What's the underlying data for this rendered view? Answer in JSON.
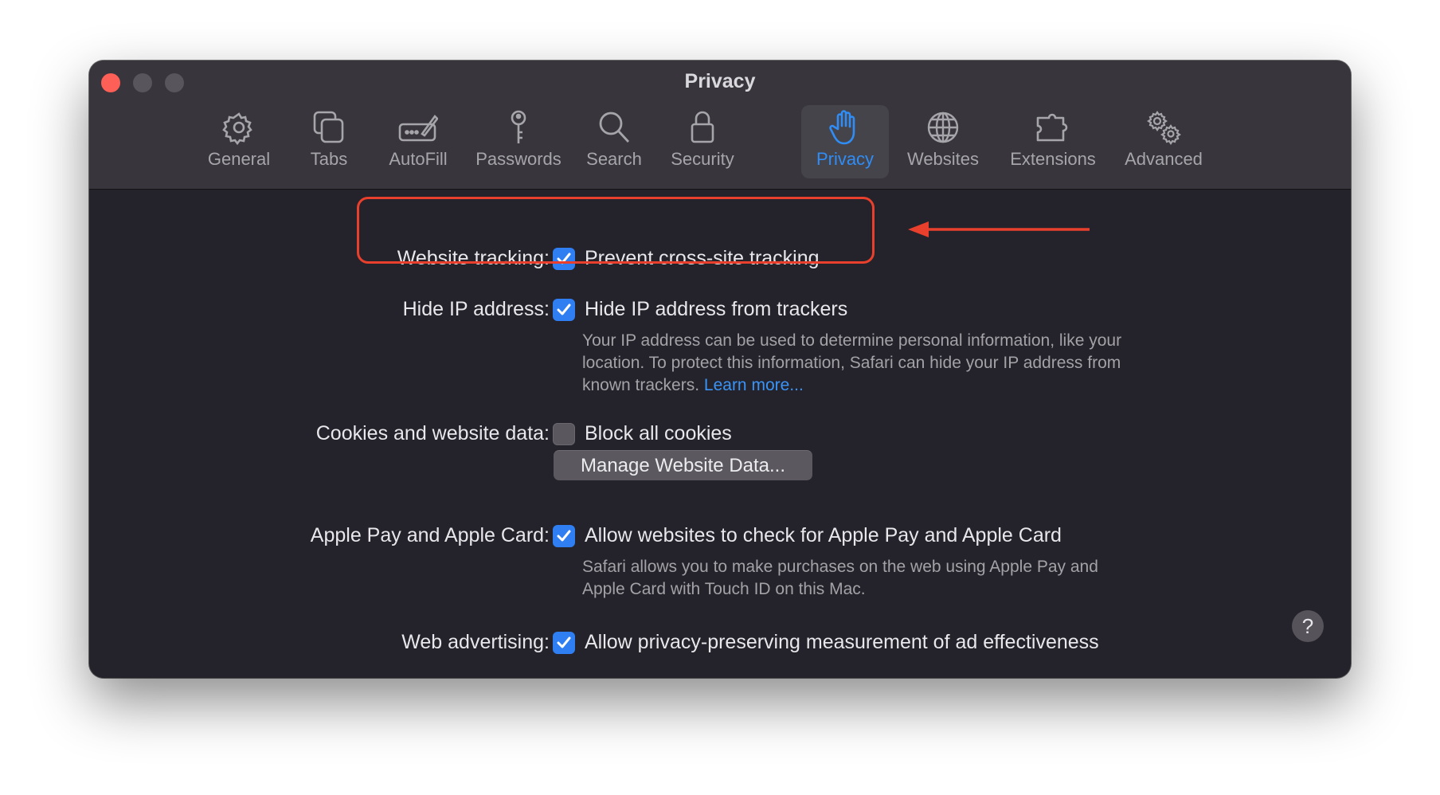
{
  "window": {
    "title": "Privacy"
  },
  "tabs": [
    {
      "label": "General",
      "icon": "gear-icon"
    },
    {
      "label": "Tabs",
      "icon": "tabs-icon"
    },
    {
      "label": "AutoFill",
      "icon": "autofill-icon"
    },
    {
      "label": "Passwords",
      "icon": "key-icon"
    },
    {
      "label": "Search",
      "icon": "magnifier-icon"
    },
    {
      "label": "Security",
      "icon": "lock-icon"
    },
    {
      "label": "Privacy",
      "icon": "hand-icon",
      "active": true
    },
    {
      "label": "Websites",
      "icon": "globe-icon"
    },
    {
      "label": "Extensions",
      "icon": "puzzle-icon"
    },
    {
      "label": "Advanced",
      "icon": "gears-icon"
    }
  ],
  "settings": {
    "tracking": {
      "label": "Website tracking:",
      "option": "Prevent cross-site tracking",
      "checked": true
    },
    "hide_ip": {
      "label": "Hide IP address:",
      "option": "Hide IP address from trackers",
      "checked": true,
      "description": "Your IP address can be used to determine personal information, like your location. To protect this information, Safari can hide your IP address from known trackers.",
      "link": "Learn more..."
    },
    "cookies": {
      "label": "Cookies and website data:",
      "option": "Block all cookies",
      "checked": false,
      "button": "Manage Website Data..."
    },
    "apple_pay": {
      "label": "Apple Pay and Apple Card:",
      "option": "Allow websites to check for Apple Pay and Apple Card",
      "checked": true,
      "description": "Safari allows you to make purchases on the web using Apple Pay and Apple Card with Touch ID on this Mac."
    },
    "ads": {
      "label": "Web advertising:",
      "option": "Allow privacy-preserving measurement of ad effectiveness",
      "checked": true
    }
  },
  "help": {
    "symbol": "?"
  },
  "colors": {
    "accent": "#2f8df5",
    "annotation": "#e8402c",
    "background": "#24222a",
    "toolbar": "#38363c"
  }
}
